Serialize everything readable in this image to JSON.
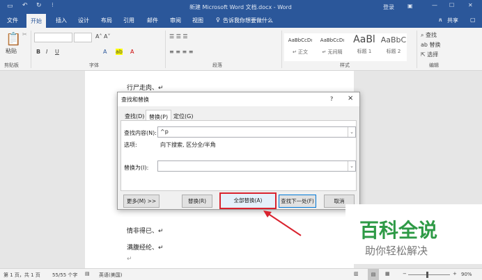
{
  "titlebar": {
    "title": "新建 Microsoft Word 文档.docx - Word",
    "login": "登录",
    "qat": [
      "save-icon",
      "undo-icon",
      "redo-icon",
      "customize-icon"
    ]
  },
  "tabs": [
    "文件",
    "开始",
    "插入",
    "设计",
    "布局",
    "引用",
    "邮件",
    "审阅",
    "视图"
  ],
  "tell_me": "告诉我你想要做什么",
  "share": "共享",
  "ribbon": {
    "groups": [
      "剪贴板",
      "字体",
      "段落",
      "样式",
      "编辑"
    ],
    "paste": "粘贴",
    "styles": [
      {
        "preview": "AaBbCcDı",
        "name": "↵ 正文"
      },
      {
        "preview": "AaBbCcDı",
        "name": "↵ 无间隔"
      },
      {
        "preview": "AaBl",
        "name": "标题 1"
      },
      {
        "preview": "AaBbC",
        "name": "标题 2"
      }
    ],
    "editing": [
      "查找",
      "替换",
      "选择"
    ]
  },
  "document": {
    "lines": [
      "行尸走肉、↵",
      "情非得已、↵",
      "满腹经纶、↵",
      "↵"
    ]
  },
  "dialog": {
    "title": "查找和替换",
    "help": "?",
    "close": "×",
    "tabs": [
      "查找(D)",
      "替换(P)",
      "定位(G)"
    ],
    "find_label": "查找内容(N):",
    "find_value": "^p",
    "options_label": "选项:",
    "options_value": "向下搜索, 区分全/半角",
    "replace_label": "替换为(I):",
    "replace_value": "",
    "buttons": {
      "more": "更多(M) >>",
      "replace": "替换(R)",
      "replace_all": "全部替换(A)",
      "find_next": "查找下一处(F)",
      "cancel": "取消"
    }
  },
  "status": {
    "page": "第 1 页，共 1 页",
    "words": "55/55 个字",
    "language": "英语(美国)",
    "zoom": "90%"
  },
  "watermark": {
    "title": "百科全说",
    "subtitle": "助你轻松解决"
  },
  "colors": {
    "brand": "#2b579a",
    "highlight": "#d9232e",
    "watermark": "#2e9a46"
  }
}
